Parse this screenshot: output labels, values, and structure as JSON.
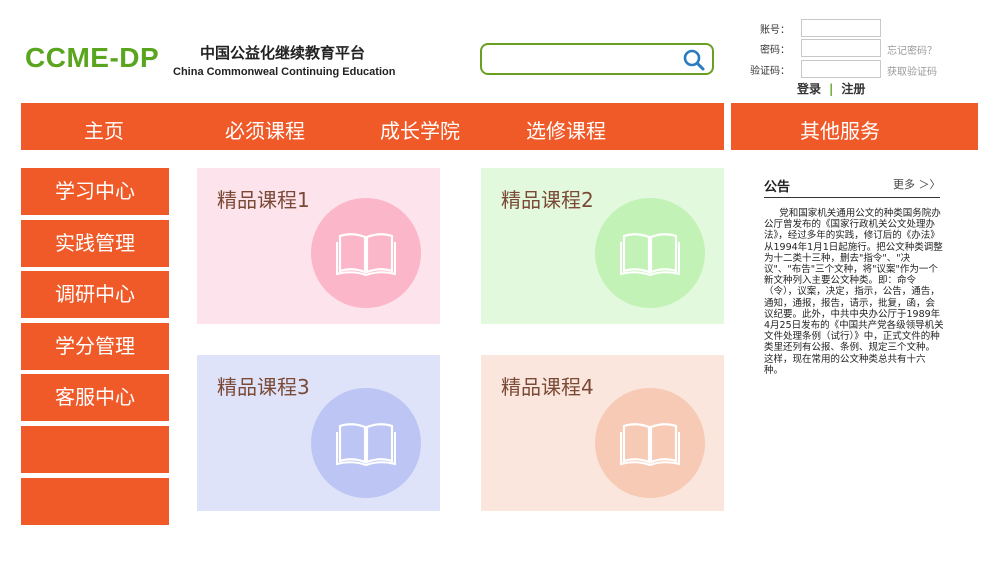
{
  "header": {
    "logo": "CCME-DP",
    "title_cn": "中国公益化继续教育平台",
    "title_en": "China Commonweal Continuing Education"
  },
  "search": {
    "value": "",
    "placeholder": ""
  },
  "login": {
    "account_label": "账号：",
    "password_label": "密码：",
    "captcha_label": "验证码：",
    "forgot_password": "忘记密码？",
    "get_captcha": "获取验证码",
    "login": "登录",
    "separator": "|",
    "register": "注册"
  },
  "nav": {
    "items": [
      "主页",
      "必须课程",
      "成长学院",
      "选修课程"
    ],
    "other": "其他服务"
  },
  "sidebar": {
    "items": [
      "学习中心",
      "实践管理",
      "调研中心",
      "学分管理",
      "客服中心",
      "",
      ""
    ]
  },
  "cards": [
    {
      "title": "精品课程1",
      "bg": "#fde3eb",
      "circle": "#fbb6c9"
    },
    {
      "title": "精品课程2",
      "bg": "#e3f9dd",
      "circle": "#c2f2b6"
    },
    {
      "title": "精品课程3",
      "bg": "#dfe3f9",
      "circle": "#bcc5f3"
    },
    {
      "title": "精品课程4",
      "bg": "#fae6dd",
      "circle": "#f6cab5"
    }
  ],
  "notice": {
    "title": "公告",
    "more": "更多 ＞〉",
    "body": "党和国家机关通用公文的种类国务院办公厅曾发布的《国家行政机关公文处理办法》，经过多年的实践，修订后的《办法》从1994年1月1日起施行。把公文种类调整为十二类十三种，删去\"指令\"、\"决议\"、\"布告\"三个文种，将\"议案\"作为一个新文种列入主要公文种类。即：命令（令），议案，决定，指示，公告，通告，通知，通报，报告，请示，批复，函，会议纪要。此外，中共中央办公厅于1989年4月25日发布的《中国共产党各级领导机关文件处理条例（试行）》中，正式文件的种类里还列有公报、条例、规定三个文种。这样，现在常用的公文种类总共有十六种。"
  },
  "colors": {
    "accent": "#f05a28",
    "logo_green": "#5aa51e",
    "search_icon": "#2a7bbf"
  }
}
